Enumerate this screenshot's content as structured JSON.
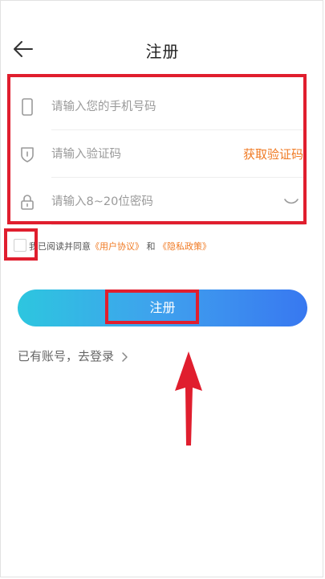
{
  "header": {
    "title": "注册",
    "back_icon": "arrow-left-icon"
  },
  "form": {
    "phone": {
      "placeholder": "请输入您的手机号码",
      "value": "",
      "icon": "phone-icon"
    },
    "code": {
      "placeholder": "请输入验证码",
      "value": "",
      "icon": "shield-icon",
      "get_code_label": "获取验证码"
    },
    "password": {
      "placeholder": "请输入8~20位密码",
      "value": "",
      "icon": "lock-icon",
      "toggle_icon": "eye-closed-icon"
    }
  },
  "agreement": {
    "checked": false,
    "prefix": "我已阅读并同意",
    "user_agreement": "《用户协议》",
    "conjunction": "和",
    "privacy_policy": "《隐私政策》"
  },
  "register_button": {
    "label": "注册"
  },
  "login_link": {
    "label": "已有账号，去登录",
    "icon": "chevron-right-icon"
  },
  "colors": {
    "accent_orange": "#f07a23",
    "annotation_red": "#e01e2e",
    "button_gradient_start": "#2dc6df",
    "button_gradient_end": "#3878f0"
  }
}
